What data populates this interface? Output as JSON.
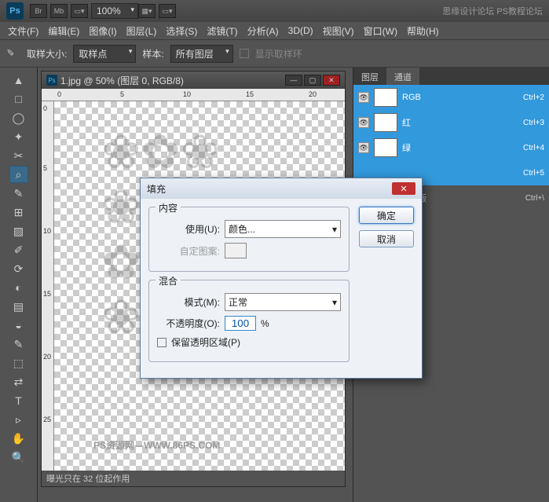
{
  "title_right": "思缘设计论坛    PS教程论坛",
  "menu": [
    "文件(F)",
    "编辑(E)",
    "图像(I)",
    "图层(L)",
    "选择(S)",
    "滤镜(T)",
    "分析(A)",
    "3D(D)",
    "视图(V)",
    "窗口(W)",
    "帮助(H)"
  ],
  "options": {
    "size_label": "取样大小:",
    "size_value": "取样点",
    "sample_label": "样本:",
    "sample_value": "所有图层",
    "show_ring": "显示取样环"
  },
  "zoom_value": "100%",
  "doc": {
    "title": "1.jpg @ 50% (图层 0, RGB/8)",
    "status": "曝光只在 32 位起作用",
    "watermark": "PS资源网—WWW.86PS.COM",
    "ruler_h": [
      "0",
      "5",
      "10",
      "15",
      "20"
    ],
    "ruler_v": [
      "0",
      "5",
      "10",
      "15",
      "20",
      "25"
    ]
  },
  "panels": {
    "tabs": [
      "图层",
      "通道"
    ],
    "channels": [
      {
        "name": "RGB",
        "shortcut": "Ctrl+2"
      },
      {
        "name": "红",
        "shortcut": "Ctrl+3"
      },
      {
        "name": "绿",
        "shortcut": "Ctrl+4"
      },
      {
        "name": "",
        "shortcut": "Ctrl+5"
      },
      {
        "name": "0 蒙版",
        "shortcut": "Ctrl+\\"
      }
    ]
  },
  "dialog": {
    "title": "填充",
    "content_legend": "内容",
    "use_label": "使用(U):",
    "use_value": "颜色...",
    "pattern_label": "自定图案:",
    "blend_legend": "混合",
    "mode_label": "模式(M):",
    "mode_value": "正常",
    "opacity_label": "不透明度(O):",
    "opacity_value": "100",
    "opacity_pct": "%",
    "preserve_label": "保留透明区域(P)",
    "ok": "确定",
    "cancel": "取消"
  },
  "tools": [
    "▲",
    "□",
    "◯",
    "✦",
    "✂",
    "⌕",
    "✎",
    "⊞",
    "▨",
    "✐",
    "⟳",
    "◐",
    "▤",
    "◒",
    "✎",
    "◧",
    "⬚",
    "⇄",
    "T",
    "▹",
    "⬠",
    "✋",
    "🔍"
  ]
}
